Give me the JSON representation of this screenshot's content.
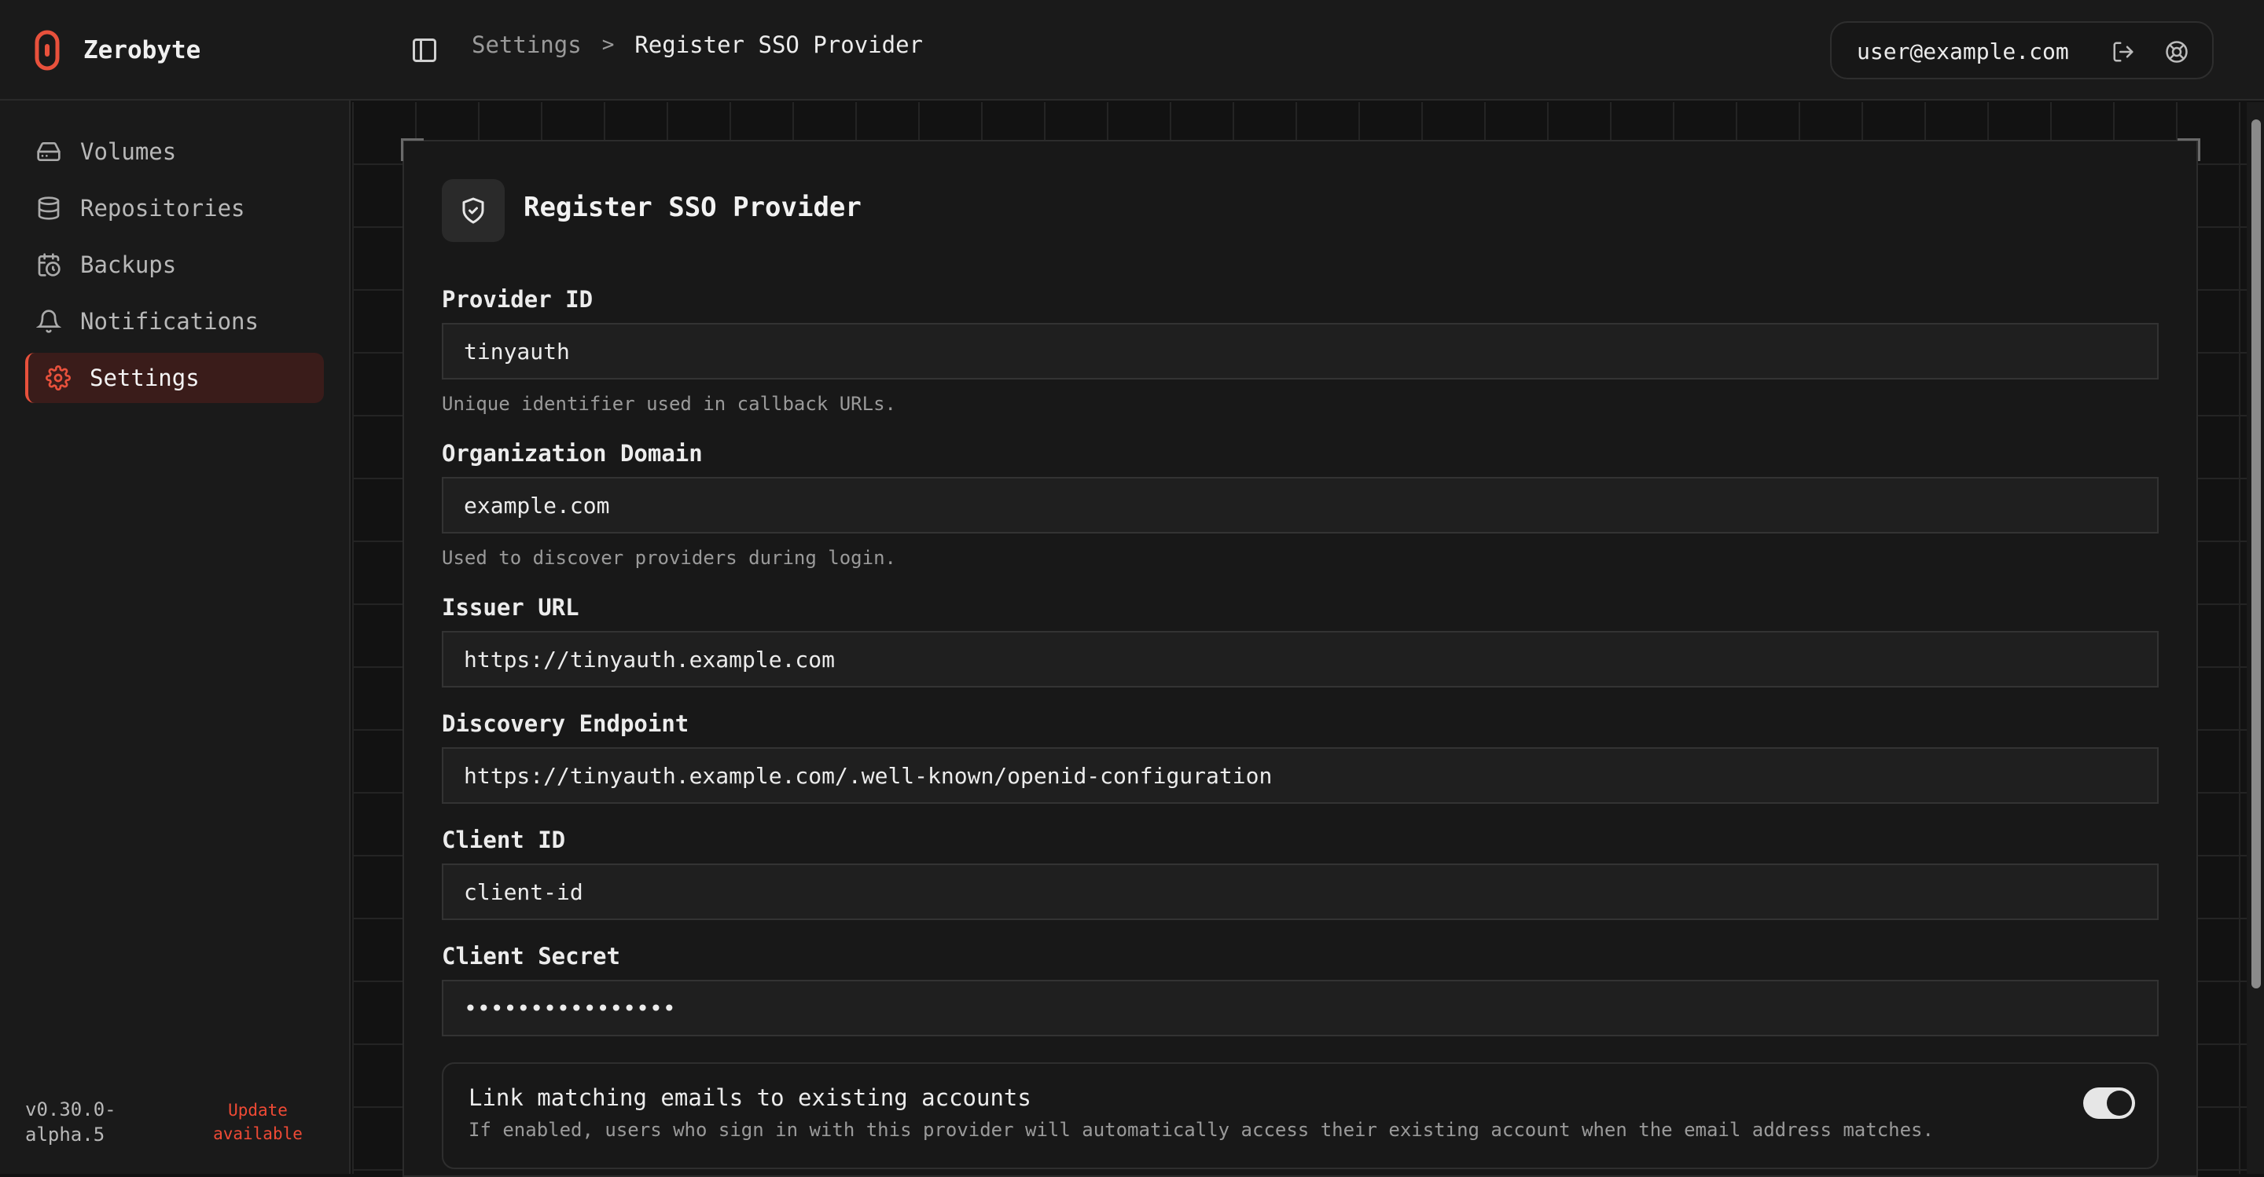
{
  "app": {
    "name": "Zerobyte",
    "accent_color": "#e8513c"
  },
  "breadcrumb": {
    "parent": "Settings",
    "separator": ">",
    "current": "Register SSO Provider"
  },
  "user": {
    "email": "user@example.com",
    "icons": [
      "sidebar-toggle-icon",
      "logout-icon",
      "help-icon"
    ]
  },
  "sidebar": {
    "items": [
      {
        "label": "Volumes",
        "icon": "hard-drive-icon",
        "active": false
      },
      {
        "label": "Repositories",
        "icon": "database-icon",
        "active": false
      },
      {
        "label": "Backups",
        "icon": "calendar-clock-icon",
        "active": false
      },
      {
        "label": "Notifications",
        "icon": "bell-icon",
        "active": false
      },
      {
        "label": "Settings",
        "icon": "gear-icon",
        "active": true
      }
    ],
    "version": "v0.30.0-alpha.5",
    "update_label": "Update available"
  },
  "form": {
    "title": "Register SSO Provider",
    "title_icon": "shield-check-icon",
    "fields": [
      {
        "label": "Provider ID",
        "value": "tinyauth",
        "hint": "Unique identifier used in callback URLs."
      },
      {
        "label": "Organization Domain",
        "value": "example.com",
        "hint": "Used to discover providers during login."
      },
      {
        "label": "Issuer URL",
        "value": "https://tinyauth.example.com",
        "hint": ""
      },
      {
        "label": "Discovery Endpoint",
        "value": "https://tinyauth.example.com/.well-known/openid-configuration",
        "hint": ""
      },
      {
        "label": "Client ID",
        "value": "client-id",
        "hint": ""
      },
      {
        "label": "Client Secret",
        "value": "••••••••••••••••",
        "hint": ""
      }
    ],
    "link_accounts": {
      "title": "Link matching emails to existing accounts",
      "description": "If enabled, users who sign in with this provider will automatically access their existing account when the email address matches.",
      "enabled": true
    }
  }
}
